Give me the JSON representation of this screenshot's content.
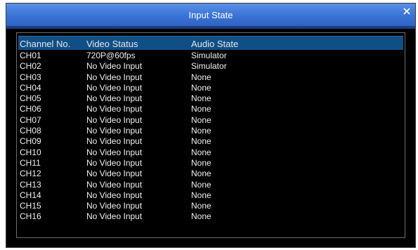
{
  "dialog": {
    "title": "Input State",
    "close_glyph": "✕"
  },
  "table": {
    "headers": [
      "Channel No.",
      "Video Status",
      "Audio  State"
    ],
    "rows": [
      [
        "CH01",
        "720P@60fps",
        "Simulator"
      ],
      [
        "CH02",
        "No  Video  Input",
        "Simulator"
      ],
      [
        "CH03",
        "No  Video  Input",
        "None"
      ],
      [
        "CH04",
        "No  Video  Input",
        "None"
      ],
      [
        "CH05",
        "No  Video  Input",
        "None"
      ],
      [
        "CH06",
        "No  Video  Input",
        "None"
      ],
      [
        "CH07",
        "No  Video  Input",
        "None"
      ],
      [
        "CH08",
        "No  Video  Input",
        "None"
      ],
      [
        "CH09",
        "No  Video  Input",
        "None"
      ],
      [
        "CH10",
        "No  Video  Input",
        "None"
      ],
      [
        "CH11",
        "No  Video  Input",
        "None"
      ],
      [
        "CH12",
        "No  Video  Input",
        "None"
      ],
      [
        "CH13",
        "No  Video  Input",
        "None"
      ],
      [
        "CH14",
        "No  Video  Input",
        "None"
      ],
      [
        "CH15",
        "No  Video  Input",
        "None"
      ],
      [
        "CH16",
        "No  Video  Input",
        "None"
      ]
    ]
  },
  "colors": {
    "titlebar": "#3a73d6",
    "header": "#0f4f86",
    "background": "#000000",
    "text": "#f0f0f0"
  }
}
